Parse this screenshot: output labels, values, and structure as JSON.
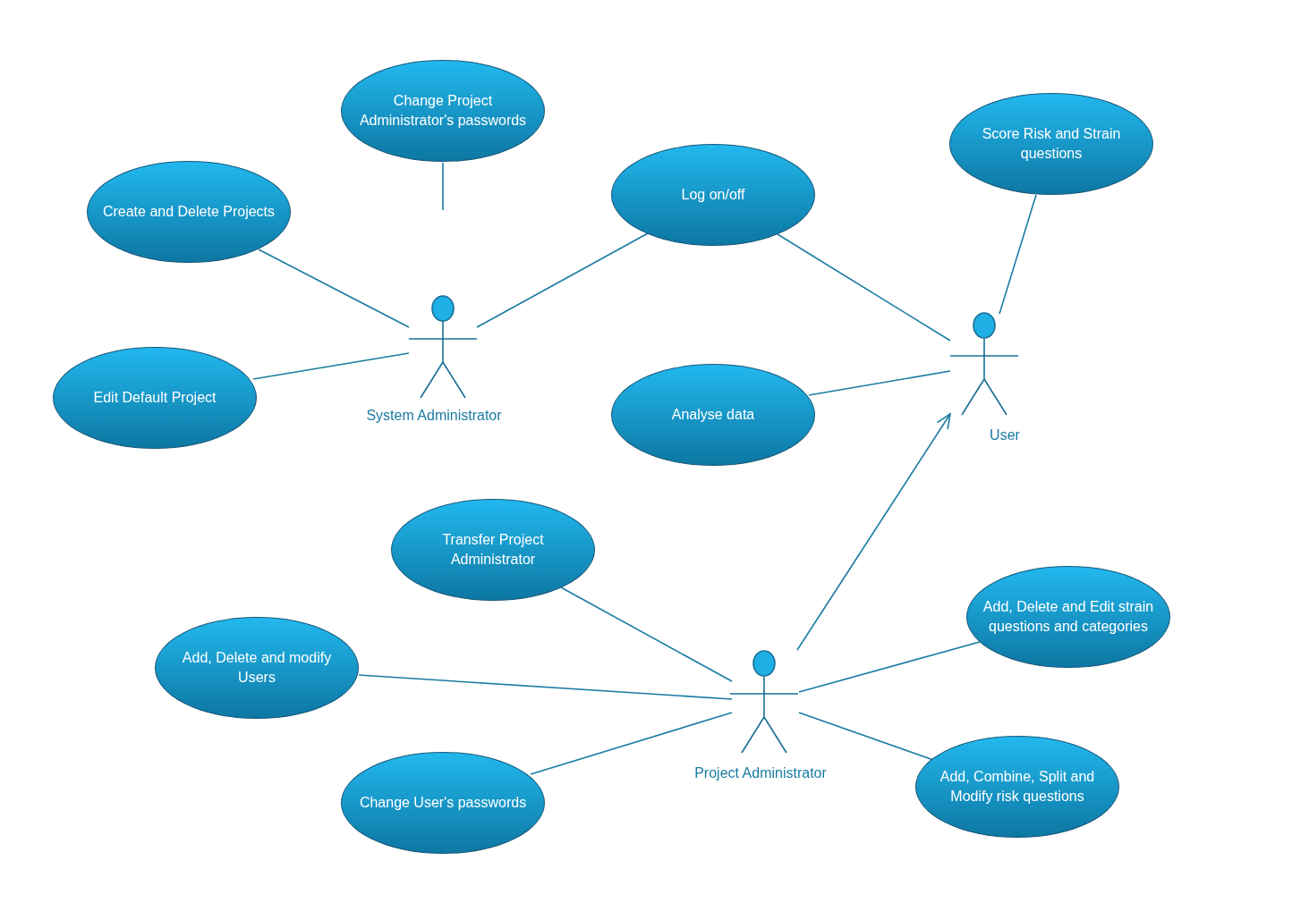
{
  "use_cases": [
    {
      "label": "Change Project Administrator's passwords"
    },
    {
      "label": "Create and Delete Projects"
    },
    {
      "label": "Edit Default Project"
    },
    {
      "label": "Log on/off"
    },
    {
      "label": "Score Risk and Strain questions"
    },
    {
      "label": "Analyse data"
    },
    {
      "label": "Transfer Project Administrator"
    },
    {
      "label": "Add, Delete and modify Users"
    },
    {
      "label": "Change User's passwords"
    },
    {
      "label": "Add, Delete and Edit strain questions and categories"
    },
    {
      "label": "Add, Combine, Split and Modify risk questions"
    }
  ],
  "actors": [
    {
      "name": "System Administrator"
    },
    {
      "name": "User"
    },
    {
      "name": "Project Administrator"
    }
  ]
}
